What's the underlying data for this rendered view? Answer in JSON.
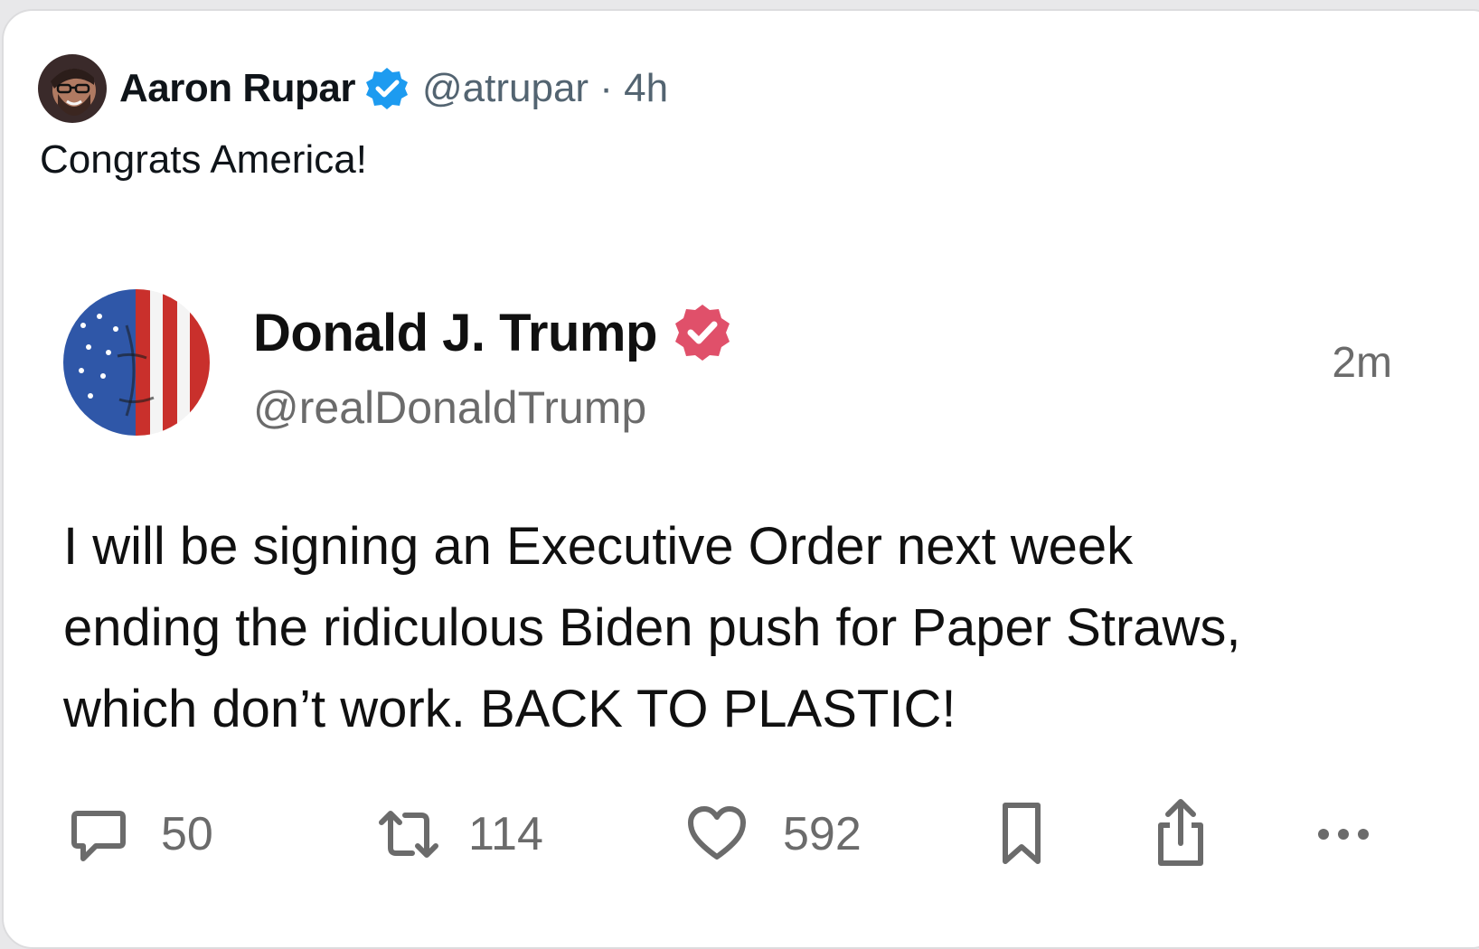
{
  "outer_post": {
    "author_name": "Aaron Rupar",
    "handle_time": "@atrupar · 4h",
    "text": "Congrats America!",
    "badge_color": "#1d9bf0"
  },
  "quoted_post": {
    "author_name": "Donald J. Trump",
    "handle": "@realDonaldTrump",
    "time": "2m",
    "badge_color": "#e0506a",
    "body_lines": [
      "I will be signing an Executive Order next week",
      "ending the ridiculous Biden push for Paper Straws,",
      "which don’t work. BACK TO PLASTIC!"
    ]
  },
  "actions": {
    "replies": "50",
    "reposts": "114",
    "likes": "592",
    "icons": [
      "reply-icon",
      "repost-icon",
      "like-icon",
      "bookmark-icon",
      "share-icon",
      "more-icon"
    ]
  }
}
